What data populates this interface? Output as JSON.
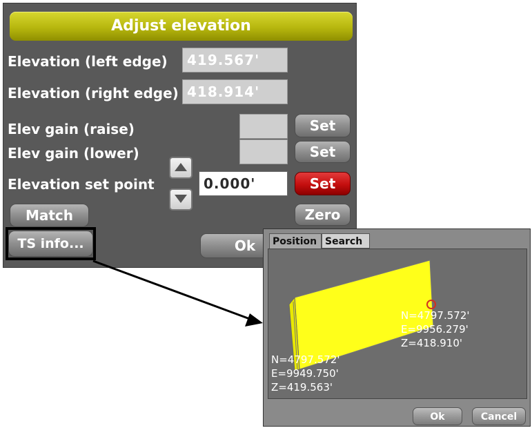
{
  "adjust": {
    "title": "Adjust elevation",
    "left_edge_label": "Elevation (left edge)",
    "left_edge_value": "419.567'",
    "right_edge_label": "Elevation (right edge)",
    "right_edge_value": "418.914'",
    "gain_raise_label": "Elev gain (raise)",
    "gain_lower_label": "Elev gain (lower)",
    "set_point_label": "Elevation set point",
    "set_point_value": "0.000'",
    "set_label": "Set",
    "match_label": "Match",
    "zero_label": "Zero",
    "ts_info_label": "TS info...",
    "ok_label": "Ok"
  },
  "position": {
    "tabs": [
      "Position",
      "Search"
    ],
    "right_point": {
      "n": "N=4797.572'",
      "e": "E=9956.279'",
      "z": "Z=418.910'"
    },
    "left_point": {
      "n": "N=4797.572'",
      "e": "E=9949.750'",
      "z": "Z=419.563'"
    },
    "ok_label": "Ok",
    "cancel_label": "Cancel"
  },
  "colors": {
    "title_bar": "#b7b70e",
    "dialog_bg": "#595959",
    "blade": "#ffff1a",
    "set_active": "#c40e0e",
    "highlight": "#000000"
  }
}
